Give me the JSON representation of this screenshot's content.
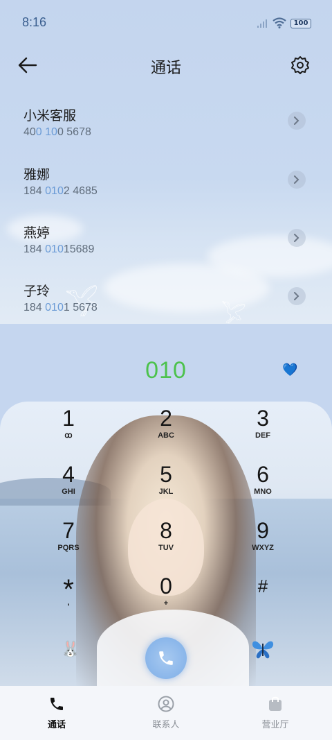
{
  "status_bar": {
    "time": "8:16",
    "battery": "100"
  },
  "header": {
    "title": "通话"
  },
  "contacts": [
    {
      "name": "小米客服",
      "num_pre": "40",
      "num_hl": "0 10",
      "num_post": "0 5678"
    },
    {
      "name": "雅娜",
      "num_pre": "184 ",
      "num_hl": "010",
      "num_post": "2 4685"
    },
    {
      "name": "燕婷",
      "num_pre": "184 ",
      "num_hl": "010",
      "num_post": "15689"
    },
    {
      "name": "子玲",
      "num_pre": "184 ",
      "num_hl": "010",
      "num_post": "1 5678"
    }
  ],
  "dialer": {
    "number": "010",
    "heart_icon": "heart-icon"
  },
  "keypad": [
    {
      "digit": "1",
      "letters": "ꝏ"
    },
    {
      "digit": "2",
      "letters": "ABC"
    },
    {
      "digit": "3",
      "letters": "DEF"
    },
    {
      "digit": "4",
      "letters": "GHI"
    },
    {
      "digit": "5",
      "letters": "JKL"
    },
    {
      "digit": "6",
      "letters": "MNO"
    },
    {
      "digit": "7",
      "letters": "PQRS"
    },
    {
      "digit": "8",
      "letters": "TUV"
    },
    {
      "digit": "9",
      "letters": "WXYZ"
    },
    {
      "digit": "*",
      "letters": ","
    },
    {
      "digit": "0",
      "letters": "+"
    },
    {
      "digit": "#",
      "letters": ""
    }
  ],
  "bottom_nav": [
    {
      "label": "通话",
      "icon": "phone-icon",
      "active": true
    },
    {
      "label": "联系人",
      "icon": "person-icon",
      "active": false
    },
    {
      "label": "营业厅",
      "icon": "shopping-bag-icon",
      "active": false
    }
  ],
  "colors": {
    "accent_green": "#4cc24c",
    "highlight_blue": "#6b9bd6",
    "call_button": "#8ab6ea"
  }
}
